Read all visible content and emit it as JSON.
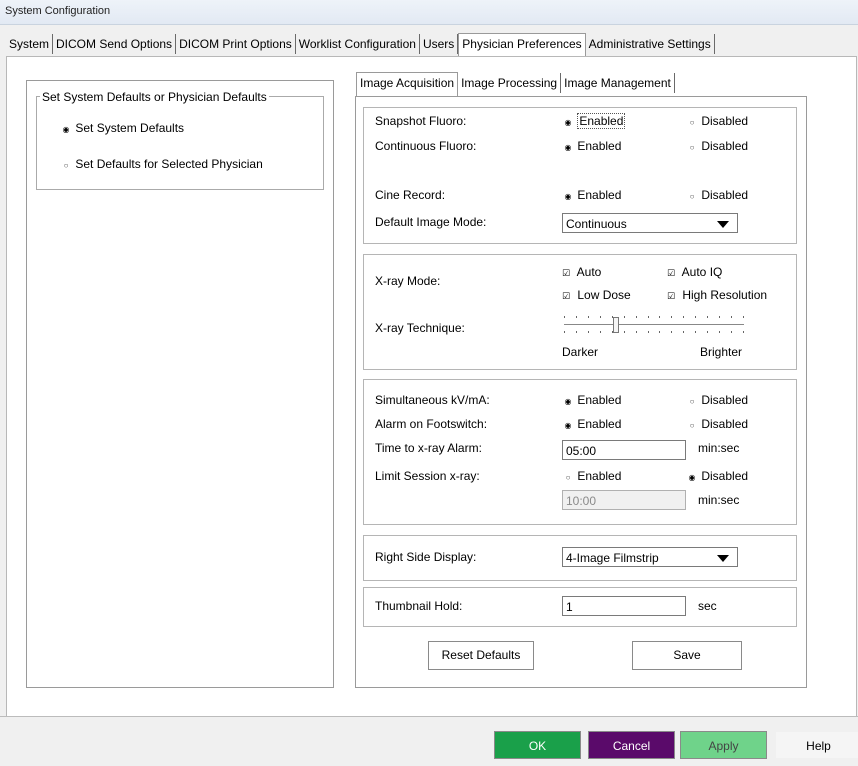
{
  "window": {
    "title": "System Configuration"
  },
  "main_tabs": [
    "System",
    "DICOM Send Options",
    "DICOM Print Options",
    "Worklist Configuration",
    "Users",
    "Physician Preferences",
    "Administrative Settings"
  ],
  "defaults_group": {
    "legend": "Set System Defaults or Physician Defaults",
    "option_system": "Set System Defaults",
    "option_physician": "Set Defaults for Selected Physician",
    "selected": "system"
  },
  "sub_tabs": [
    "Image Acquisition",
    "Image Processing",
    "Image Management"
  ],
  "acquisition": {
    "snapshot_fluoro": {
      "label": "Snapshot Fluoro:",
      "enabled": "Enabled",
      "disabled": "Disabled",
      "selected": "enabled"
    },
    "continuous_fluoro": {
      "label": "Continuous Fluoro:",
      "enabled": "Enabled",
      "disabled": "Disabled",
      "selected": "enabled"
    },
    "cine_record": {
      "label": "Cine Record:",
      "enabled": "Enabled",
      "disabled": "Disabled",
      "selected": "enabled"
    },
    "default_image_mode": {
      "label": "Default Image Mode:",
      "value": "Continuous"
    }
  },
  "xray": {
    "mode_label": "X-ray Mode:",
    "auto": "Auto",
    "auto_iq": "Auto IQ",
    "low_dose": "Low Dose",
    "high_resolution": "High Resolution",
    "technique_label": "X-ray Technique:",
    "darker": "Darker",
    "brighter": "Brighter",
    "technique_level": 0.28
  },
  "alarms": {
    "simultaneous": {
      "label": "Simultaneous kV/mA:",
      "enabled": "Enabled",
      "disabled": "Disabled",
      "selected": "enabled"
    },
    "footswitch": {
      "label": "Alarm on Footswitch:",
      "enabled": "Enabled",
      "disabled": "Disabled",
      "selected": "enabled"
    },
    "time_alarm": {
      "label": "Time to x-ray Alarm:",
      "value": "05:00",
      "unit": "min:sec"
    },
    "limit_session": {
      "label": "Limit Session x-ray:",
      "enabled": "Enabled",
      "disabled": "Disabled",
      "selected": "disabled",
      "value": "10:00",
      "unit": "min:sec"
    }
  },
  "display": {
    "label": "Right Side Display:",
    "value": "4-Image Filmstrip"
  },
  "thumbnail": {
    "label": "Thumbnail Hold:",
    "value": "1",
    "unit": "sec"
  },
  "panel_buttons": {
    "reset": "Reset Defaults",
    "save": "Save"
  },
  "dialog_buttons": {
    "ok": "OK",
    "cancel": "Cancel",
    "apply": "Apply",
    "help": "Help"
  },
  "colors": {
    "ok": "#1aa04a",
    "cancel": "#5a0a6a",
    "apply": "#6fd38a"
  }
}
